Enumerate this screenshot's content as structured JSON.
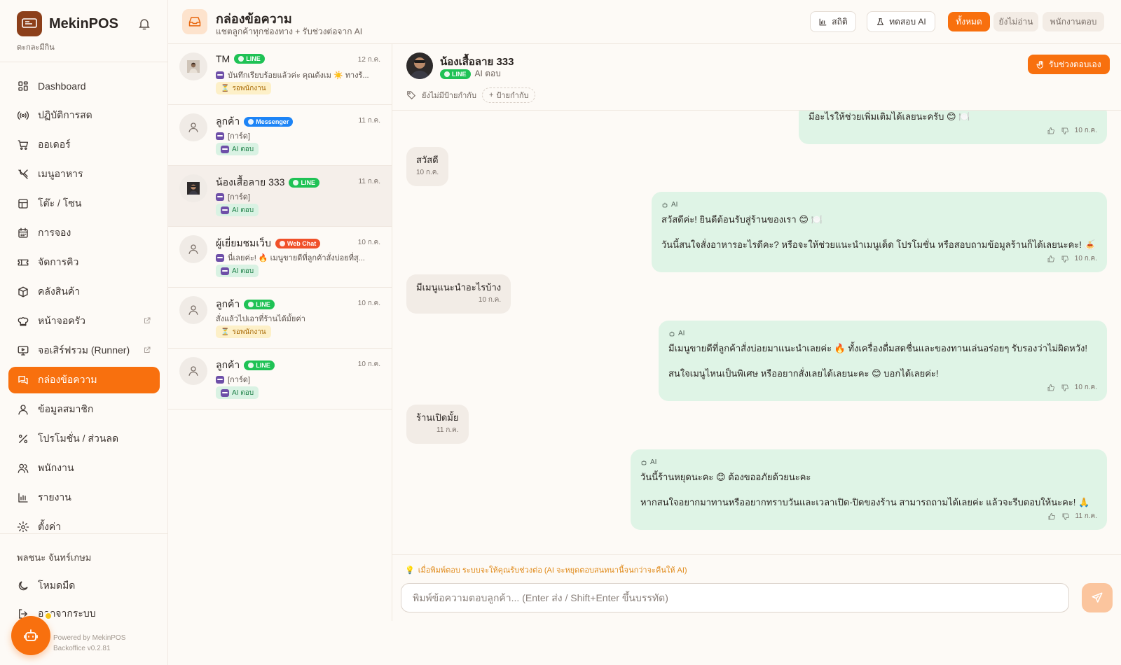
{
  "sidebar": {
    "brand_name": "MekinPOS",
    "brand_sub": "ตะกละมีกิน",
    "logo_text": "MekinPOS",
    "items": [
      {
        "label": "Dashboard",
        "icon": "grid-icon"
      },
      {
        "label": "ปฏิบัติการสด",
        "icon": "broadcast-icon"
      },
      {
        "label": "ออเดอร์",
        "icon": "cart-icon"
      },
      {
        "label": "เมนูอาหาร",
        "icon": "utensils-icon"
      },
      {
        "label": "โต๊ะ / โซน",
        "icon": "table-icon"
      },
      {
        "label": "การจอง",
        "icon": "calendar-icon"
      },
      {
        "label": "จัดการคิว",
        "icon": "ticket-icon"
      },
      {
        "label": "คลังสินค้า",
        "icon": "box-icon"
      },
      {
        "label": "หน้าจอครัว",
        "icon": "chef-hat-icon"
      },
      {
        "label": "จอเสิร์ฟรวม (Runner)",
        "icon": "monitor-icon"
      },
      {
        "label": "กล่องข้อความ",
        "icon": "chat-icon"
      },
      {
        "label": "ข้อมูลสมาชิก",
        "icon": "user-icon"
      },
      {
        "label": "โปรโมชั่น / ส่วนลด",
        "icon": "percent-icon"
      },
      {
        "label": "พนักงาน",
        "icon": "users-icon"
      },
      {
        "label": "รายงาน",
        "icon": "bar-chart-icon"
      },
      {
        "label": "ตั้งค่า",
        "icon": "gear-icon"
      }
    ],
    "active_index": 10,
    "user_name": "พลชนะ จันทร์เกษม",
    "dark_mode_label": "โหมดมืด",
    "logout_label": "ออกจากระบบ",
    "powered_line1": "Powered by MekinPOS",
    "powered_line2": "Backoffice v0.2.81"
  },
  "header": {
    "title": "กล่องข้อความ",
    "subtitle": "แชตลูกค้าทุกช่องทาง + รับช่วงต่อจาก AI",
    "stats_label": "สถิติ",
    "test_ai_label": "ทดสอบ AI",
    "filters": [
      "ทั้งหมด",
      "ยังไม่อ่าน",
      "พนักงานตอบ"
    ],
    "active_filter": 0
  },
  "conversations": [
    {
      "name": "TM",
      "channel": "LINE",
      "time": "12 ก.ค.",
      "preview": "บันทึกเรียบร้อยแล้วค่ะ คุณต้งเม ☀️ ทางร้...",
      "bot": true,
      "status": "รอพนักงาน",
      "status_type": "wait",
      "avatar": "photo"
    },
    {
      "name": "ลูกค้า",
      "channel": "Messenger",
      "time": "11 ก.ค.",
      "preview": "[การ์ด]",
      "bot": true,
      "status": "AI ตอบ",
      "status_type": "ai",
      "avatar": "default"
    },
    {
      "name": "น้องเสื้อลาย 333",
      "channel": "LINE",
      "time": "11 ก.ค.",
      "preview": "[การ์ด]",
      "bot": true,
      "status": "AI ตอบ",
      "status_type": "ai",
      "avatar": "photo2",
      "selected": true
    },
    {
      "name": "ผู้เยี่ยมชมเว็บ",
      "channel": "Web Chat",
      "time": "10 ก.ค.",
      "preview": "นี่เลยค่ะ! 🔥 เมนูขายดีที่ลูกค้าสั่งบ่อยที่สุ...",
      "bot": true,
      "status": "AI ตอบ",
      "status_type": "ai",
      "avatar": "default"
    },
    {
      "name": "ลูกค้า",
      "channel": "LINE",
      "time": "10 ก.ค.",
      "preview": "สั่งแล้วไปเอาที่ร้านได้มั้ยค่า",
      "bot": false,
      "status": "รอพนักงาน",
      "status_type": "wait",
      "avatar": "default"
    },
    {
      "name": "ลูกค้า",
      "channel": "LINE",
      "time": "10 ก.ค.",
      "preview": "[การ์ด]",
      "bot": true,
      "status": "AI ตอบ",
      "status_type": "ai",
      "avatar": "default"
    }
  ],
  "chat": {
    "name": "น้องเสื้อลาย 333",
    "channel": "LINE",
    "mode": "AI ตอบ",
    "no_tag": "ยังไม่มีป้ายกำกับ",
    "add_tag": "ป้ายกำกับ",
    "takeover_label": "รับช่วงตอบเอง",
    "ai_tag": "AI",
    "messages": [
      {
        "dir": "out",
        "ai": false,
        "text": "มีอะไรให้ช่วยเพิ่มเติมได้เลยนะครับ 😊 🍽️",
        "time": "10 ก.ค."
      },
      {
        "dir": "in",
        "text": "สวัสดี",
        "time": "10 ก.ค."
      },
      {
        "dir": "out",
        "ai": true,
        "text": "สวัสดีค่ะ! ยินดีต้อนรับสู่ร้านของเรา 😊 🍽️\n\nวันนี้สนใจสั่งอาหารอะไรดีคะ? หรือจะให้ช่วยแนะนำเมนูเด็ด โปรโมชั่น หรือสอบถามข้อมูลร้านก็ได้เลยนะคะ! 🍝",
        "time": "10 ก.ค."
      },
      {
        "dir": "in",
        "text": "มีเมนูแนะนำอะไรบ้าง",
        "time": "10 ก.ค."
      },
      {
        "dir": "out",
        "ai": true,
        "text": "มีเมนูขายดีที่ลูกค้าสั่งบ่อยมาแนะนำเลยค่ะ 🔥 ทั้งเครื่องดื่มสดชื่นและของทานเล่นอร่อยๆ รับรองว่าไม่ผิดหวัง!\n\nสนใจเมนูไหนเป็นพิเศษ หรืออยากสั่งเลยได้เลยนะคะ 😊 บอกได้เลยค่ะ!",
        "time": "10 ก.ค."
      },
      {
        "dir": "in",
        "text": "ร้านเปิดมั้ย",
        "time": "11 ก.ค."
      },
      {
        "dir": "out",
        "ai": true,
        "text": "วันนี้ร้านหยุดนะคะ 😊 ต้องขออภัยด้วยนะคะ\n\nหากสนใจอยากมาทานหรืออยากทราบวันและเวลาเปิด-ปิดของร้าน สามารถถามได้เลยค่ะ แล้วจะรีบตอบให้นะคะ! 🙏",
        "time": "11 ก.ค."
      }
    ]
  },
  "composer": {
    "hint": "เมื่อพิมพ์ตอบ ระบบจะให้คุณรับช่วงต่อ (AI จะหยุดตอบสนทนานี้จนกว่าจะคืนให้ AI)",
    "placeholder": "พิมพ์ข้อความตอบลูกค้า... (Enter ส่ง / Shift+Enter ขึ้นบรรทัด)",
    "value": ""
  },
  "colors": {
    "accent": "#f8700e",
    "line": "#1fc255",
    "messenger": "#1d84f6",
    "webchat": "#f0512a",
    "ai_bubble": "#dff4e6"
  }
}
